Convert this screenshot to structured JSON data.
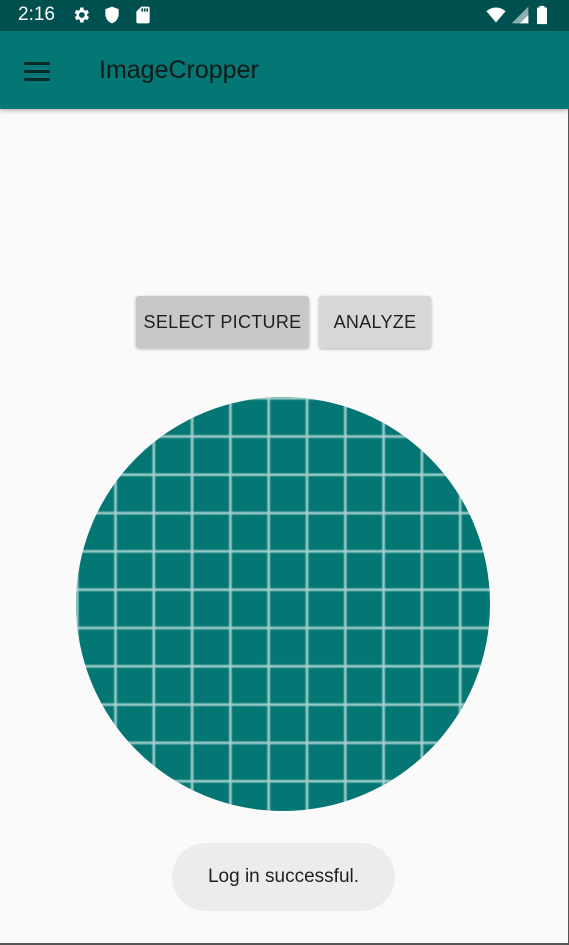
{
  "status_bar": {
    "time": "2:16",
    "left_icons": [
      "settings-gear-icon",
      "shield-icon",
      "sd-card-icon"
    ],
    "right_icons": [
      "wifi-icon",
      "signal-icon",
      "battery-icon"
    ]
  },
  "app_bar": {
    "menu_icon": "hamburger-menu-icon",
    "title": "ImageCropper"
  },
  "buttons": {
    "select_picture": "SELECT PICTURE",
    "analyze": "ANALYZE"
  },
  "crop_view": {
    "shape": "circle",
    "color": "#047673",
    "grid_color": "#cfe8e6"
  },
  "toast": {
    "message": "Log in successful."
  },
  "colors": {
    "status_bar": "#00504f",
    "app_bar": "#047673",
    "background": "#fafafa"
  }
}
